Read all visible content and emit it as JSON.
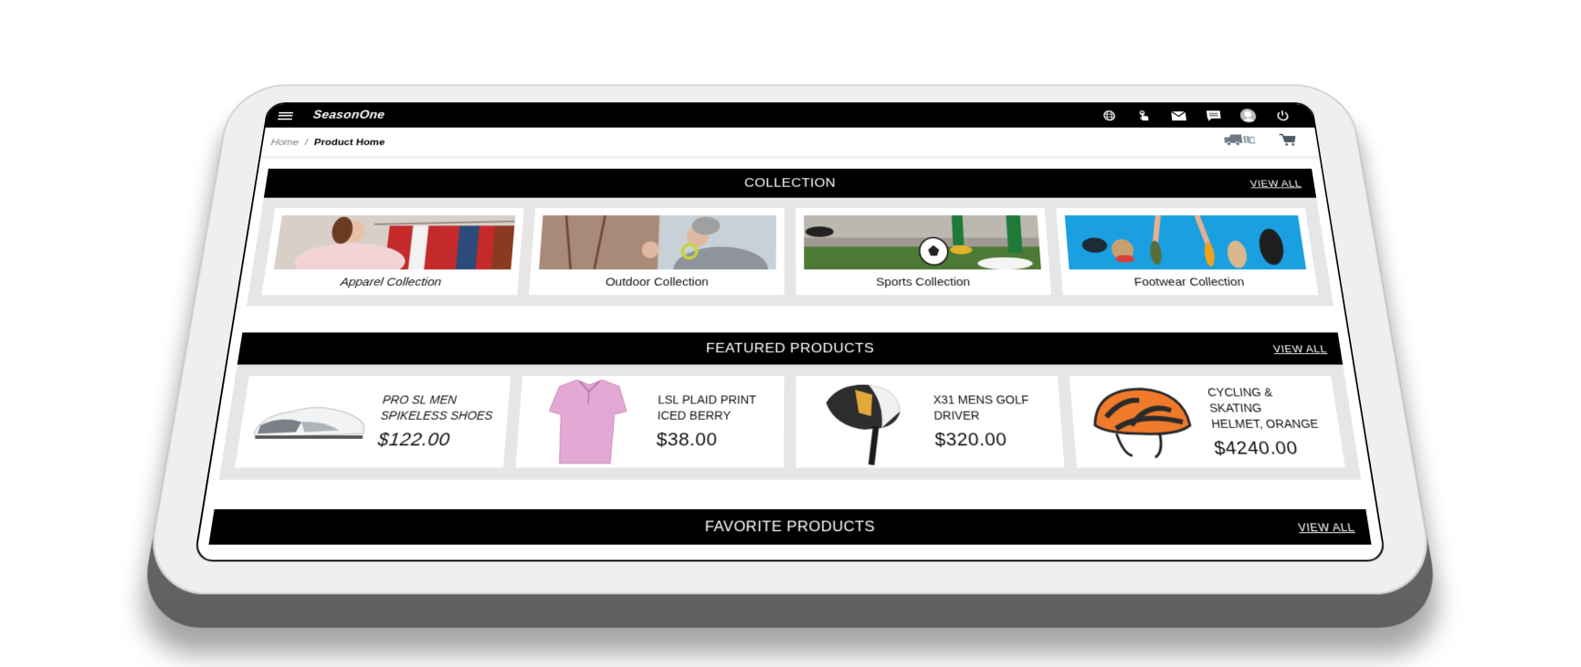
{
  "app": {
    "brand": "SeasonOne"
  },
  "navbar": {
    "icons": [
      "globe-icon",
      "touch-icon",
      "mail-icon",
      "chat-icon",
      "avatar-icon",
      "power-icon"
    ]
  },
  "breadcrumb": {
    "home": "Home",
    "separator": "/",
    "current": "Product Home"
  },
  "actions": {
    "icons": [
      "delivery-truck-icon",
      "cart-icon"
    ]
  },
  "collection": {
    "title": "COLLECTION",
    "view_all": "VIEW ALL",
    "items": [
      {
        "label": "Apparel Collection"
      },
      {
        "label": "Outdoor Collection"
      },
      {
        "label": "Sports Collection"
      },
      {
        "label": "Footwear Collection"
      }
    ]
  },
  "featured": {
    "title": "FEATURED PRODUCTS",
    "view_all": "VIEW ALL",
    "items": [
      {
        "name_line1": "PRO SL MEN",
        "name_line2": "SPIKELESS SHOES",
        "price": "$122.00"
      },
      {
        "name_line1": "LSL PLAID PRINT",
        "name_line2": "ICED BERRY",
        "price": "$38.00"
      },
      {
        "name_line1": "X31 MENS GOLF",
        "name_line2": "DRIVER",
        "price": "$320.00"
      },
      {
        "name_line1": "CYCLING & SKATING",
        "name_line2": "HELMET, ORANGE",
        "price": "$4240.00"
      }
    ]
  },
  "favorite": {
    "title": "FAVORITE PRODUCTS",
    "view_all": "VIEW ALL"
  },
  "colors": {
    "header_bg": "#000000",
    "section_bg": "#e6e6e6",
    "tablet_body": "#efefef",
    "breadcrumb_muted": "#7a7d86"
  }
}
